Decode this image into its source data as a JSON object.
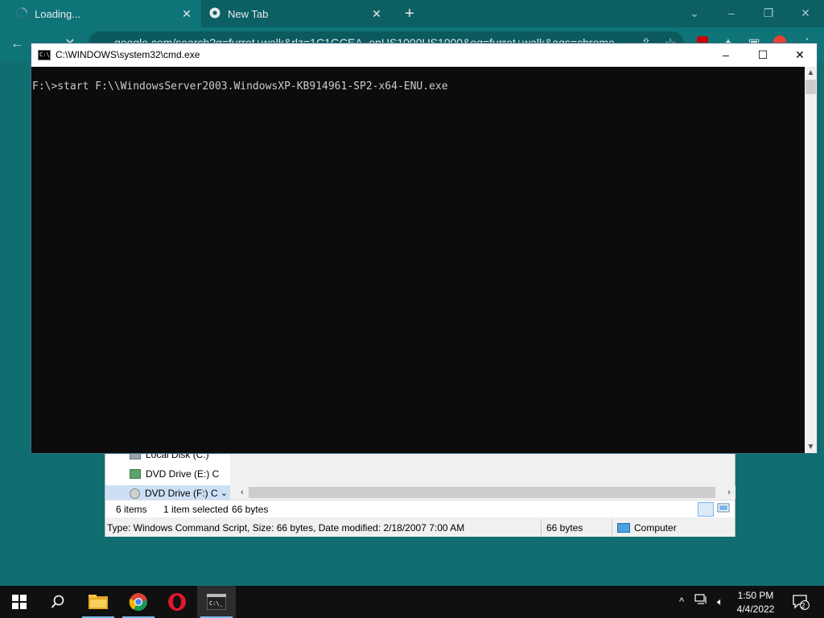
{
  "browser": {
    "tabs": [
      {
        "label": "Loading..."
      },
      {
        "label": "New Tab"
      }
    ],
    "address": "google.com/search?q=furret+walk&rlz=1C1GCEA_enUS1000US1000&oq=furret+walk&aqs=chrome"
  },
  "cmd": {
    "title": "C:\\WINDOWS\\system32\\cmd.exe",
    "icon_text": "C:\\_",
    "line": "F:\\>start F:\\\\WindowsServer2003.WindowsXP-KB914961-SP2-x64-ENU.exe"
  },
  "explorer": {
    "tree": [
      {
        "label": "Local Disk (C:)"
      },
      {
        "label": "DVD Drive (E:) C"
      },
      {
        "label": "DVD Drive (F:) C"
      }
    ],
    "status_items": "6 items",
    "status_selected": "1 item selected",
    "status_size": "66 bytes",
    "details": "Type: Windows Command Script, Size: 66 bytes, Date modified: 2/18/2007 7:00 AM",
    "details_size": "66 bytes",
    "details_location": "Computer"
  },
  "taskbar": {
    "time": "1:50 PM",
    "date": "4/4/2022",
    "notification_count": "2"
  },
  "colors": {
    "desktop": "#116e70",
    "cmd_bg": "#0c0c0c",
    "cmd_text": "#cccccc",
    "taskbar": "#101010"
  }
}
